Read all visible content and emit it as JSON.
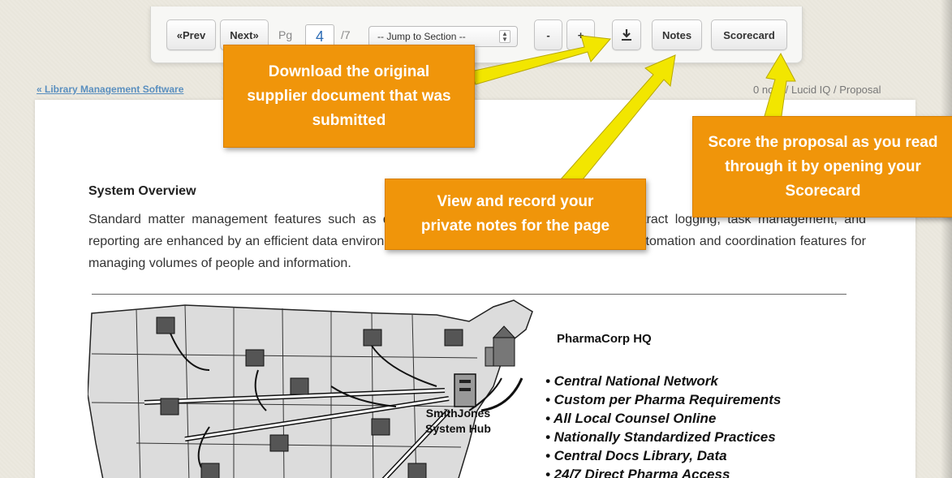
{
  "toolbar": {
    "prev_label": "«Prev",
    "next_label": "Next»",
    "pg_label": "Pg",
    "page_value": "4",
    "page_total": "/7",
    "jump_label": "-- Jump to Section --",
    "zoom_out_label": "-",
    "zoom_in_label": "+",
    "download_icon": "download-icon",
    "notes_label": "Notes",
    "scorecard_label": "Scorecard"
  },
  "breadcrumb": {
    "back_link": "« Library Management Software",
    "trail": "0 no... / Lucid IQ / Proposal"
  },
  "document": {
    "heading": "System Overview",
    "paragraph": "Standard matter management features such as data management, document creation, contract logging, task management, and reporting are enhanced by an efficient data environment, record cross-referencing, as well as automation and coordination features for managing volumes of people and information.",
    "figure": {
      "hq_label": "PharmaCorp HQ",
      "hub_label_line1": "SmithJones",
      "hub_label_line2": "System Hub",
      "bullets": [
        "• Central National Network",
        "• Custom per  Pharma Requirements",
        "• All Local Counsel Online",
        "• Nationally Standardized Practices",
        "• Central Docs Library, Data",
        "• 24/7 Direct Pharma Access"
      ]
    }
  },
  "callouts": {
    "download": "Download the original supplier document that was submitted",
    "notes": "View and record your private notes for the page",
    "scorecard": "Score the proposal as you read through it by opening your Scorecard"
  },
  "colors": {
    "callout": "#f0950a",
    "arrow": "#f2e600",
    "link": "#5a8fbf"
  }
}
